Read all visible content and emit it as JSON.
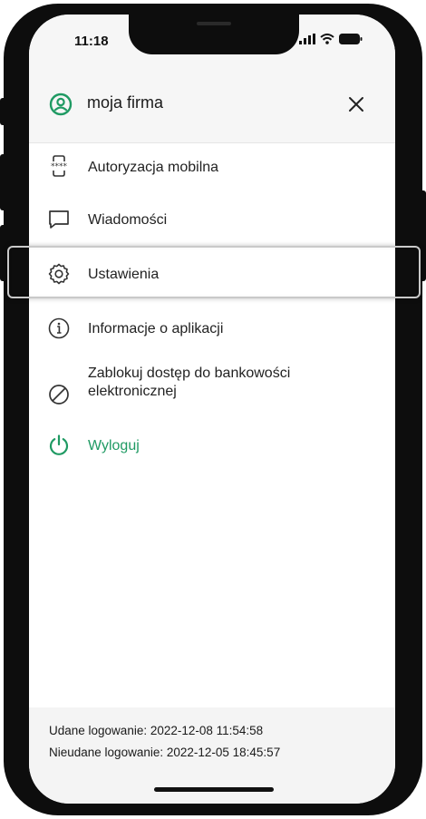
{
  "status_bar": {
    "time": "11:18",
    "icons": [
      "signal-icon",
      "wifi-icon",
      "battery-icon"
    ]
  },
  "header": {
    "icon": "profile-icon",
    "title": "moja firma",
    "close_icon": "close-icon"
  },
  "menu": {
    "items": [
      {
        "label": "Autoryzacja mobilna",
        "icon": "mobile-authorization-icon"
      },
      {
        "label": "Wiadomości",
        "icon": "message-icon"
      },
      {
        "label": "Ustawienia",
        "icon": "settings-icon",
        "highlighted": true
      },
      {
        "label": "Informacje o aplikacji",
        "icon": "info-icon"
      },
      {
        "label": "Zablokuj dostęp do bankowości",
        "label_line2": "elektronicznej",
        "icon": "block-icon"
      },
      {
        "label": "Wyloguj",
        "icon": "power-icon",
        "color": "#1f9a63"
      }
    ]
  },
  "footer": {
    "successful_login": "Udane logowanie: 2022-12-08 11:54:58",
    "failed_login": "Nieudane logowanie: 2022-12-05 18:45:57"
  },
  "colors": {
    "accent": "#1f9a63",
    "header_bg": "#f6f6f6",
    "footer_bg": "#f4f4f4"
  }
}
